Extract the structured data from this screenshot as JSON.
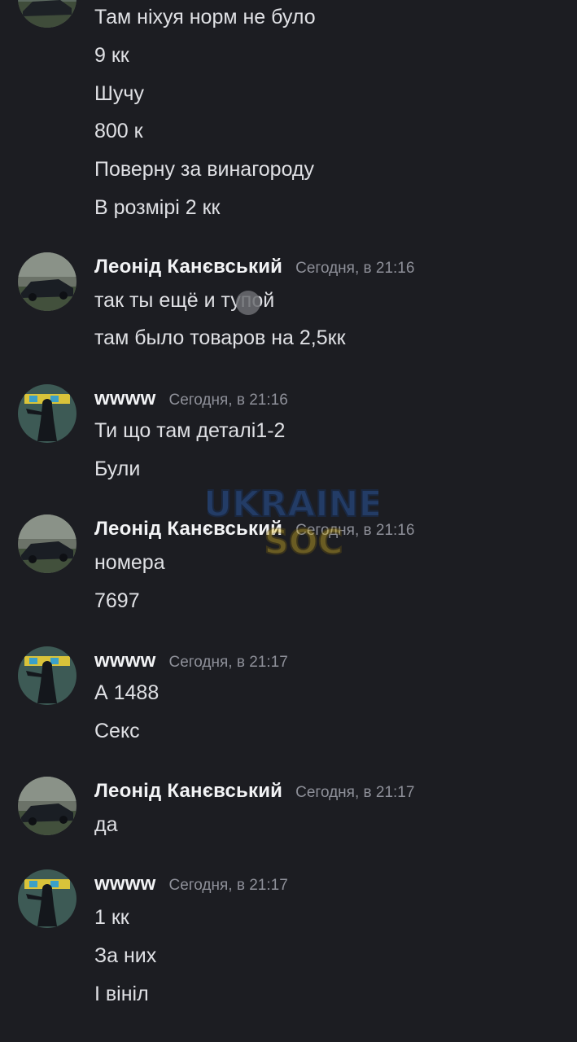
{
  "g0": {
    "messages": [
      "Там ніхуя норм не було",
      "9 кк",
      "Шучу",
      "800 к",
      "Поверну за винагороду",
      "В розмірі 2 кк"
    ]
  },
  "g1": {
    "username": "Леонід Канєвський",
    "timestamp": "Сегодня, в 21:16",
    "messages": [
      "так ты ещё и тупой",
      "там было товаров на 2,5кк"
    ]
  },
  "g2": {
    "username": "wwww",
    "timestamp": "Сегодня, в 21:16",
    "messages": [
      "Ти що там деталі1-2",
      "Були"
    ]
  },
  "g3": {
    "username": "Леонід Канєвський",
    "timestamp": "Сегодня, в 21:16",
    "messages": [
      "номера",
      "7697"
    ]
  },
  "g4": {
    "username": "wwww",
    "timestamp": "Сегодня, в 21:17",
    "messages": [
      "А 1488",
      "Секс"
    ]
  },
  "g5": {
    "username": "Леонід Канєвський",
    "timestamp": "Сегодня, в 21:17",
    "messages": [
      "да"
    ]
  },
  "g6": {
    "username": "wwww",
    "timestamp": "Сегодня, в 21:17",
    "messages": [
      "1 кк",
      "За них",
      "І вініл"
    ]
  },
  "watermark": {
    "line1": "UKRAINE",
    "line2": "SOC"
  },
  "colors": {
    "background": "#1c1d22",
    "username": "#f2f3f5",
    "timestamp": "#8e9099",
    "message_text": "#dfe0e4",
    "watermark_blue": "#2f6fd6",
    "watermark_yellow": "#e8c327"
  },
  "icons": {
    "avatar_car": "car-photo-avatar",
    "avatar_graffiti": "graffiti-figure-avatar"
  }
}
